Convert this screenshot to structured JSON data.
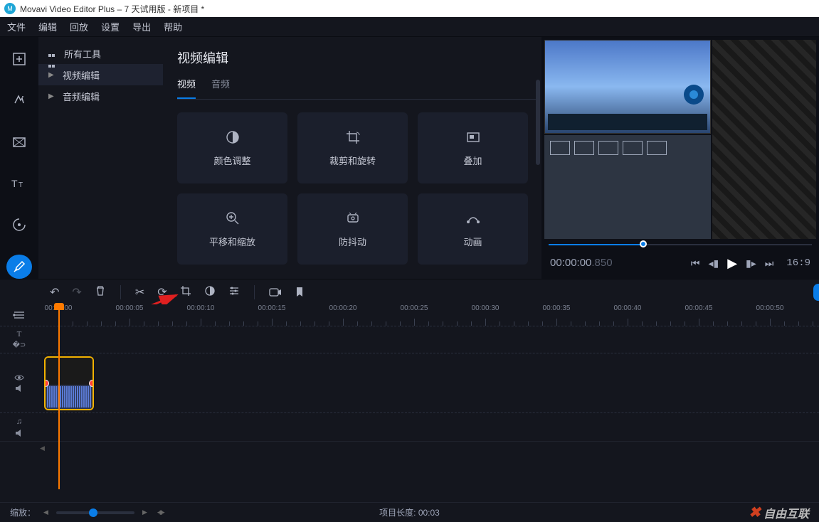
{
  "title": "Movavi Video Editor Plus – 7 天试用版 - 新项目 *",
  "menu": [
    "文件",
    "编辑",
    "回放",
    "设置",
    "导出",
    "帮助"
  ],
  "rail": [
    {
      "name": "import-icon"
    },
    {
      "name": "effects-icon"
    },
    {
      "name": "transitions-icon"
    },
    {
      "name": "text-icon"
    },
    {
      "name": "stickers-icon"
    },
    {
      "name": "more-tools-icon",
      "active": true
    }
  ],
  "sidebar": {
    "items": [
      {
        "label": "所有工具",
        "icon": "grid"
      },
      {
        "label": "视频编辑",
        "icon": "chev",
        "selected": true
      },
      {
        "label": "音频编辑",
        "icon": "chev"
      }
    ]
  },
  "panel": {
    "title": "视频编辑",
    "tabs": [
      {
        "label": "视频",
        "active": true
      },
      {
        "label": "音频"
      }
    ],
    "tools": [
      {
        "label": "颜色调整",
        "icon": "contrast"
      },
      {
        "label": "裁剪和旋转",
        "icon": "crop"
      },
      {
        "label": "叠加",
        "icon": "overlay"
      },
      {
        "label": "平移和缩放",
        "icon": "zoom"
      },
      {
        "label": "防抖动",
        "icon": "stabilize"
      },
      {
        "label": "动画",
        "icon": "animate"
      }
    ]
  },
  "preview": {
    "time": "00:00:00",
    "time_frac": ".850",
    "ratio": "16:9"
  },
  "ruler": {
    "start": "00:00:00",
    "labels": [
      "00:00:05",
      "00:00:10",
      "00:00:15",
      "00:00:20",
      "00:00:25",
      "00:00:30",
      "00:00:35",
      "00:00:40",
      "00:00:45",
      "00:00:50"
    ]
  },
  "status": {
    "zoom_label": "缩放：",
    "projlen_label": "项目长度: ",
    "projlen_value": "00:03",
    "watermark": "自由互联"
  }
}
